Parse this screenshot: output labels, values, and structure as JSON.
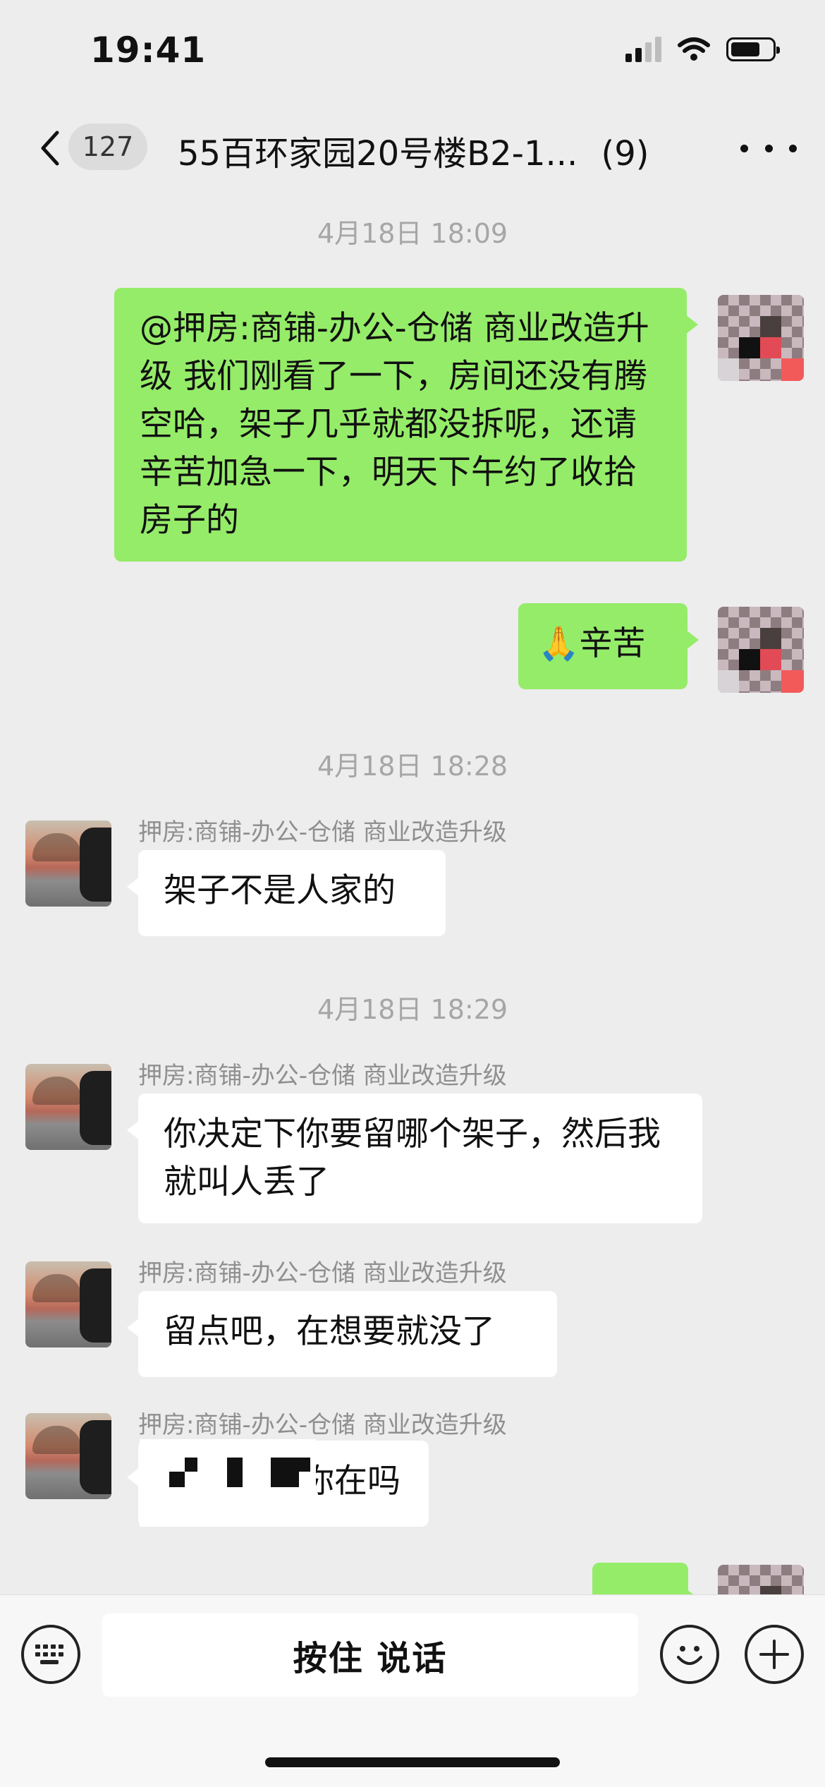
{
  "status_bar": {
    "time": "19:41"
  },
  "nav": {
    "unread_count": "127",
    "title": "55百环家园20号楼B2-1...",
    "member_count": "(9)"
  },
  "messages": {
    "ts1": "4月18日 18:09",
    "m1_text": "@押房:商铺-办公-仓储 商业改造升级 我们刚看了一下，房间还没有腾空哈，架子几乎就都没拆呢，还请辛苦加急一下，明天下午约了收拾房子的",
    "m2_text": "🙏辛苦",
    "ts2": "4月18日 18:28",
    "m3_sender": "押房:商铺-办公-仓储 商业改造升级",
    "m3_text": "架子不是人家的",
    "ts3": "4月18日 18:29",
    "m4_sender": "押房:商铺-办公-仓储 商业改造升级",
    "m4_text": "你决定下你要留哪个架子，然后我就叫人丢了",
    "m5_sender": "押房:商铺-办公-仓储 商业改造升级",
    "m5_text": "留点吧，在想要就没了",
    "m6_sender": "押房:商铺-办公-仓储 商业改造升级",
    "m6_text": "你在吗"
  },
  "input_bar": {
    "talk_label": "按住 说话"
  },
  "colors": {
    "self_bubble": "#95ec69",
    "other_bubble": "#ffffff",
    "background": "#ededed"
  }
}
